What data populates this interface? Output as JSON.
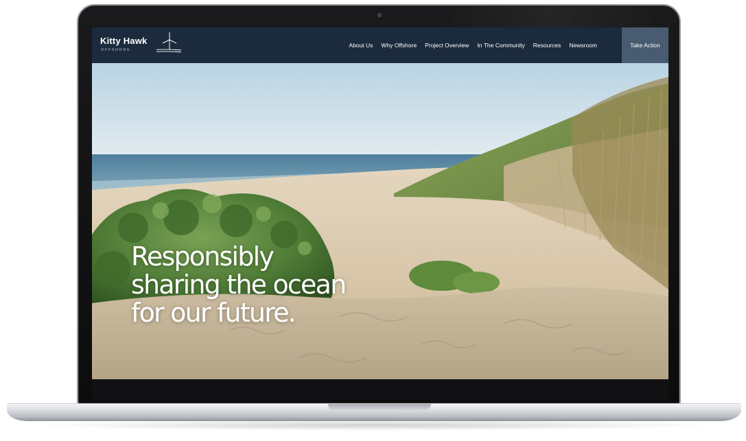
{
  "brand": {
    "name": "Kitty Hawk",
    "subtitle": "OFFSHORE"
  },
  "nav": {
    "items": [
      {
        "label": "About Us"
      },
      {
        "label": "Why Offshore"
      },
      {
        "label": "Project Overview"
      },
      {
        "label": "In The Community"
      },
      {
        "label": "Resources"
      },
      {
        "label": "Newsroom"
      }
    ],
    "cta_label": "Take Action"
  },
  "hero": {
    "headline_lines": [
      "Responsibly",
      "sharing the ocean",
      "for our future."
    ]
  },
  "colors": {
    "navbar": "#1b2a3c",
    "cta": "#495b70",
    "text": "#ffffff"
  },
  "icons": {
    "logo": "wind-turbine-icon",
    "camera": "camera-dot"
  }
}
